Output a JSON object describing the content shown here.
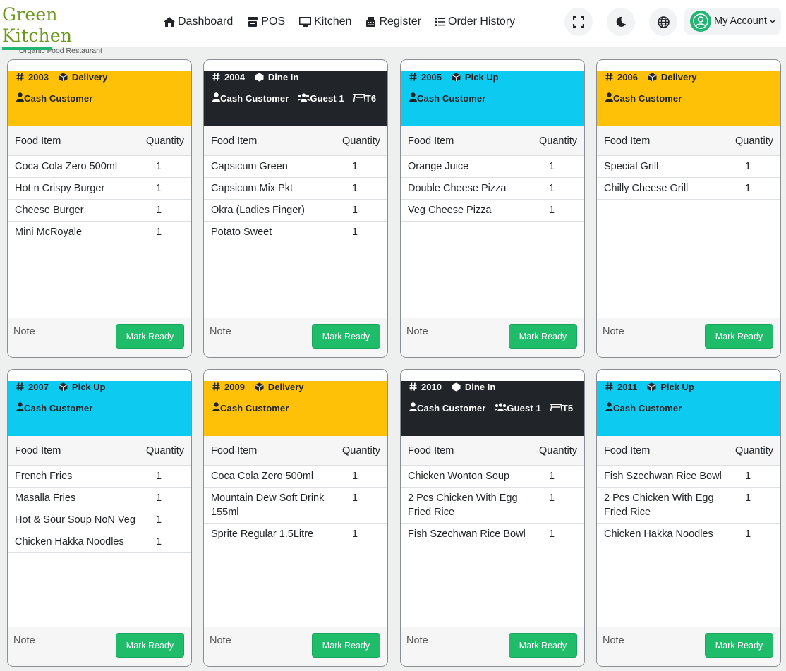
{
  "brand": {
    "name": "Green Kitchen",
    "subtitle": "Organic Food Restaurant"
  },
  "nav": [
    {
      "label": "Dashboard",
      "icon": "home-icon"
    },
    {
      "label": "POS",
      "icon": "store-icon"
    },
    {
      "label": "Kitchen",
      "icon": "monitor-icon"
    },
    {
      "label": "Register",
      "icon": "cash-register-icon"
    },
    {
      "label": "Order History",
      "icon": "list-icon"
    }
  ],
  "account": {
    "label": "My Account"
  },
  "colors": {
    "delivery": "#ffc107",
    "dine_in": "#212529",
    "pick_up": "#0dcaf0",
    "accent": "#1fbd6a"
  },
  "table_headers": {
    "item": "Food Item",
    "qty": "Quantity"
  },
  "footer": {
    "note": "Note",
    "button": "Mark Ready"
  },
  "orders": [
    {
      "hash": "#",
      "number": "2003",
      "type": "Delivery",
      "customer": "Cash Customer",
      "guest": "",
      "table": "",
      "items": [
        {
          "name": "Coca Cola Zero 500ml",
          "qty": "1"
        },
        {
          "name": "Hot n Crispy Burger",
          "qty": "1"
        },
        {
          "name": "Cheese Burger",
          "qty": "1"
        },
        {
          "name": "Mini McRoyale",
          "qty": "1"
        }
      ]
    },
    {
      "hash": "#",
      "number": "2004",
      "type": "Dine In",
      "customer": "Cash Customer",
      "guest": "Guest 1",
      "table": "T6",
      "items": [
        {
          "name": "Capsicum Green",
          "qty": "1"
        },
        {
          "name": "Capsicum Mix Pkt",
          "qty": "1"
        },
        {
          "name": "Okra (Ladies Finger)",
          "qty": "1"
        },
        {
          "name": "Potato Sweet",
          "qty": "1"
        }
      ]
    },
    {
      "hash": "#",
      "number": "2005",
      "type": "Pick Up",
      "customer": "Cash Customer",
      "guest": "",
      "table": "",
      "items": [
        {
          "name": "Orange Juice",
          "qty": "1"
        },
        {
          "name": "Double Cheese Pizza",
          "qty": "1"
        },
        {
          "name": "Veg Cheese Pizza",
          "qty": "1"
        }
      ]
    },
    {
      "hash": "#",
      "number": "2006",
      "type": "Delivery",
      "customer": "Cash Customer",
      "guest": "",
      "table": "",
      "items": [
        {
          "name": "Special Grill",
          "qty": "1"
        },
        {
          "name": "Chilly Cheese Grill",
          "qty": "1"
        }
      ]
    },
    {
      "hash": "#",
      "number": "2007",
      "type": "Pick Up",
      "customer": "Cash Customer",
      "guest": "",
      "table": "",
      "items": [
        {
          "name": "French Fries",
          "qty": "1"
        },
        {
          "name": "Masalla Fries",
          "qty": "1"
        },
        {
          "name": "Hot & Sour Soup NoN Veg",
          "qty": "1"
        },
        {
          "name": "Chicken Hakka Noodles",
          "qty": "1"
        }
      ]
    },
    {
      "hash": "#",
      "number": "2009",
      "type": "Delivery",
      "customer": "Cash Customer",
      "guest": "",
      "table": "",
      "items": [
        {
          "name": "Coca Cola Zero 500ml",
          "qty": "1"
        },
        {
          "name": "Mountain Dew Soft Drink 155ml",
          "qty": "1"
        },
        {
          "name": "Sprite Regular 1.5Litre",
          "qty": "1"
        }
      ]
    },
    {
      "hash": "#",
      "number": "2010",
      "type": "Dine In",
      "customer": "Cash Customer",
      "guest": "Guest 1",
      "table": "T5",
      "items": [
        {
          "name": "Chicken Wonton Soup",
          "qty": "1"
        },
        {
          "name": "2 Pcs Chicken With Egg Fried Rice",
          "qty": "1"
        },
        {
          "name": "Fish Szechwan Rice Bowl",
          "qty": "1"
        }
      ]
    },
    {
      "hash": "#",
      "number": "2011",
      "type": "Pick Up",
      "customer": "Cash Customer",
      "guest": "",
      "table": "",
      "items": [
        {
          "name": "Fish Szechwan Rice Bowl",
          "qty": "1"
        },
        {
          "name": "2 Pcs Chicken With Egg Fried Rice",
          "qty": "1"
        },
        {
          "name": "Chicken Hakka Noodles",
          "qty": "1"
        }
      ]
    }
  ]
}
